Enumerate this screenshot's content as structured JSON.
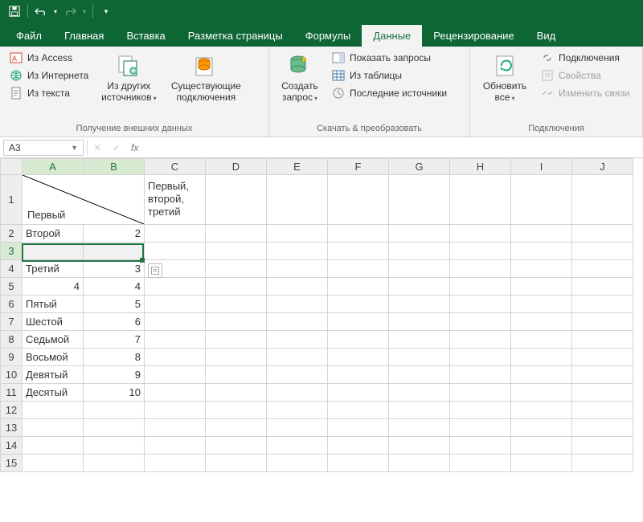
{
  "qat": {
    "save": "save",
    "undo": "undo",
    "redo": "redo"
  },
  "tabs": {
    "file": "Файл",
    "home": "Главная",
    "insert": "Вставка",
    "pagelayout": "Разметка страницы",
    "formulas": "Формулы",
    "data": "Данные",
    "review": "Рецензирование",
    "view": "Вид"
  },
  "ribbon": {
    "g1": {
      "access": "Из Access",
      "web": "Из Интернета",
      "text": "Из текста",
      "other": "Из других источников",
      "existing": "Существующие подключения",
      "label": "Получение внешних данных"
    },
    "g2": {
      "newquery": "Создать запрос",
      "showq": "Показать запросы",
      "fromtable": "Из таблицы",
      "recent": "Последние источники",
      "label": "Скачать & преобразовать"
    },
    "g3": {
      "refresh": "Обновить все",
      "conn": "Подключения",
      "props": "Свойства",
      "editlinks": "Изменить связи",
      "label": "Подключения"
    }
  },
  "namebox": "A3",
  "fx": "fx",
  "cols": [
    "A",
    "B",
    "C",
    "D",
    "E",
    "F",
    "G",
    "H",
    "I",
    "J"
  ],
  "rows": [
    "1",
    "2",
    "3",
    "4",
    "5",
    "6",
    "7",
    "8",
    "9",
    "10",
    "11",
    "12",
    "13",
    "14",
    "15"
  ],
  "cells": {
    "a1": "Первый",
    "c1": "Первый, второй, третий",
    "a2": "Второй",
    "b2": "2",
    "a4": "Третий",
    "b4": "3",
    "a5": "4",
    "b5": "4",
    "a6": "Пятый",
    "b6": "5",
    "a7": "Шестой",
    "b7": "6",
    "a8": "Седьмой",
    "b8": "7",
    "a9": "Восьмой",
    "b9": "8",
    "a10": "Девятый",
    "b10": "9",
    "a11": "Десятый",
    "b11": "10"
  }
}
